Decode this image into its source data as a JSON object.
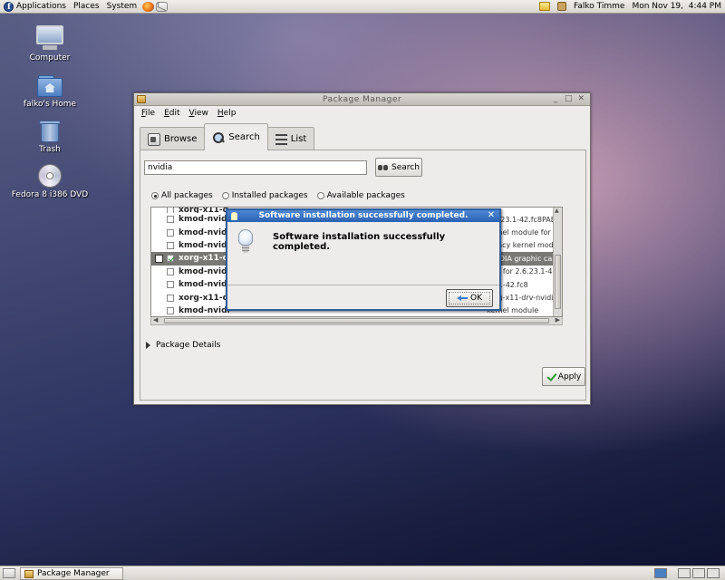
{
  "top_panel": {
    "menus": [
      "Applications",
      "Places",
      "System"
    ],
    "user": "Falko Timme",
    "clock": "Mon Nov 19,  4:44 PM"
  },
  "desktop_icons": [
    {
      "label": "Computer"
    },
    {
      "label": "falko's Home"
    },
    {
      "label": "Trash"
    },
    {
      "label": "Fedora 8 i386 DVD"
    }
  ],
  "window": {
    "title": "Package Manager",
    "menu": [
      "File",
      "Edit",
      "View",
      "Help"
    ],
    "tabs": [
      "Browse",
      "Search",
      "List"
    ],
    "active_tab": "Search",
    "search": {
      "value": "nvidia",
      "button": "Search"
    },
    "filters": {
      "options": [
        "All packages",
        "Installed packages",
        "Available packages"
      ],
      "selected": "All packages"
    },
    "packages": [
      {
        "name": "xorg-x11-dr",
        "desc": "NVIDIA graphics card",
        "checked": false,
        "partial": true
      },
      {
        "name": "kmod-nvidia",
        "desc": "2.6.23.1-42.fc8PAE",
        "checked": false
      },
      {
        "name": "kmod-nvidia",
        "desc": "kernel module for n",
        "checked": false
      },
      {
        "name": "kmod-nvidia",
        "desc": "legacy kernel modu",
        "checked": false
      },
      {
        "name": "xorg-x11-dr",
        "desc": "NVIDIA graphic cards",
        "checked": true,
        "selected": true
      },
      {
        "name": "kmod-nvidia",
        "desc": "e(s) for 2.6.23.1-4",
        "checked": false
      },
      {
        "name": "kmod-nvidia",
        "desc": "23.1-42.fc8",
        "checked": false
      },
      {
        "name": "xorg-x11-dr",
        "desc": "xorg-x11-drv-nvidia",
        "checked": false
      },
      {
        "name": "kmod-nvidia",
        "desc": "kernel module",
        "checked": false
      }
    ],
    "details_label": "Package Details",
    "apply_button": "Apply"
  },
  "dialog": {
    "title": "Software installation successfully completed.",
    "message": "Software installation successfully completed.",
    "ok_button": "OK"
  },
  "taskbar": {
    "items": [
      "Package Manager"
    ]
  }
}
